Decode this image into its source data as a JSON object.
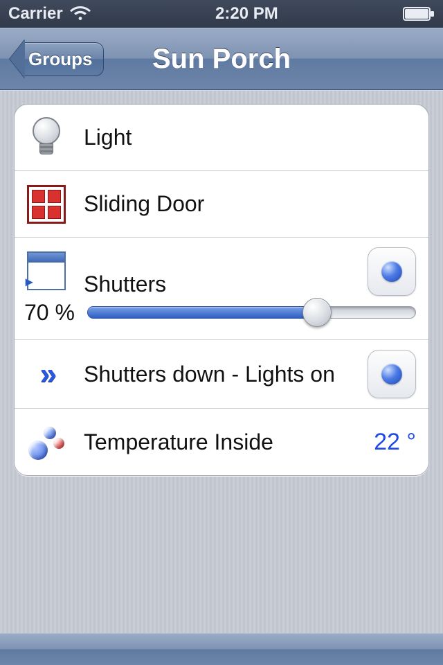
{
  "statusbar": {
    "carrier": "Carrier",
    "time": "2:20 PM"
  },
  "nav": {
    "back_label": "Groups",
    "title": "Sun Porch"
  },
  "rows": {
    "light": {
      "label": "Light"
    },
    "door": {
      "label": "Sliding Door"
    },
    "shutters": {
      "label": "Shutters",
      "percent_text": "70 %",
      "percent": 70
    },
    "scene": {
      "label": "Shutters down - Lights on"
    },
    "temp": {
      "label": "Temperature Inside",
      "value": "22 °"
    }
  }
}
